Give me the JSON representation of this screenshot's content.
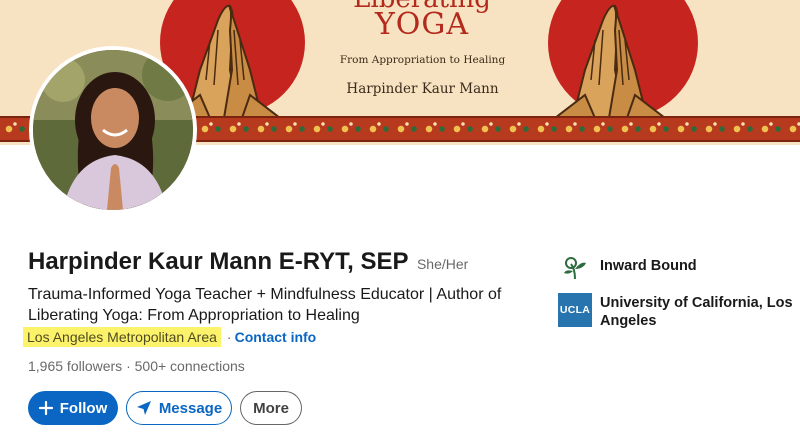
{
  "banner": {
    "title_top": "Liberating",
    "title": "YOGA",
    "subtitle": "From Appropriation to Healing",
    "author": "Harpinder Kaur Mann"
  },
  "profile": {
    "name": "Harpinder Kaur Mann E-RYT, SEP",
    "pronouns": "She/Her",
    "headline": "Trauma-Informed Yoga Teacher + Mindfulness Educator | Author of Liberating Yoga: From Appropriation to Healing",
    "location": "Los Angeles Metropolitan Area",
    "separator": "·",
    "contact_info": "Contact info",
    "followers": "1,965 followers",
    "connections": "500+ connections"
  },
  "actions": {
    "follow": "Follow",
    "message": "Message",
    "more": "More"
  },
  "organizations": [
    {
      "name": "Inward Bound",
      "logo": "inward-bound-logo"
    },
    {
      "name": "University of California, Los Angeles",
      "logo_text": "UCLA"
    }
  ],
  "colors": {
    "accent": "#0a66c2",
    "highlight": "#fdf36b",
    "banner_bg": "#f7e3c2",
    "banner_red": "#c6241f",
    "ucla_blue": "#2774ae"
  }
}
